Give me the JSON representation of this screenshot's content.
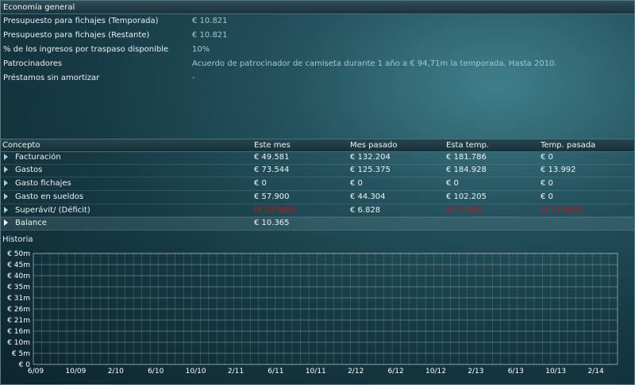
{
  "economia": {
    "title": "Economía general",
    "rows": [
      {
        "label": "Presupuesto para fichajes (Temporada)",
        "value": "€ 10.821"
      },
      {
        "label": "Presupuesto para fichajes (Restante)",
        "value": "€ 10.821"
      },
      {
        "label": "% de los ingresos por traspaso disponible",
        "value": "10%"
      },
      {
        "label": "Patrocinadores",
        "value": "Acuerdo de patrocinador de camiseta durante 1 año a € 94,71m la temporada. Hasta 2010."
      },
      {
        "label": "Préstamos sin amortizar",
        "value": "-"
      }
    ]
  },
  "table": {
    "headers": [
      "Concepto",
      "Este mes",
      "Mes pasado",
      "Esta temp.",
      "Temp. pasada"
    ],
    "rows": [
      {
        "name": "Facturación",
        "values": [
          "€ 49.581",
          "€ 132.204",
          "€ 181.786",
          "€ 0"
        ]
      },
      {
        "name": "Gastos",
        "values": [
          "€ 73.544",
          "€ 125.375",
          "€ 184.928",
          "€ 13.992"
        ]
      },
      {
        "name": "Gasto fichajes",
        "values": [
          "€ 0",
          "€ 0",
          "€ 0",
          "€ 0"
        ]
      },
      {
        "name": "Gasto en sueldos",
        "values": [
          "€ 57.900",
          "€ 44.304",
          "€ 102.205",
          "€ 0"
        ]
      },
      {
        "name": "Superávit/ (Déficit)",
        "values": [
          "(€ 23.963)",
          "€ 6.828",
          "(€ 3.142)",
          "(€ 13.992)"
        ]
      }
    ],
    "balance": {
      "name": "Balance",
      "value": "€ 10.365"
    }
  },
  "history": {
    "title": "Historia",
    "y_ticks": [
      "€ 0",
      "€ 5m",
      "€ 10m",
      "€ 16m",
      "€ 21m",
      "€ 26m",
      "€ 31m",
      "€ 35m",
      "€ 40m",
      "€ 45m",
      "€ 50m"
    ],
    "x_ticks": [
      "6/09",
      "10/09",
      "2/10",
      "6/10",
      "10/10",
      "2/11",
      "6/11",
      "10/11",
      "2/12",
      "6/12",
      "10/12",
      "2/13",
      "6/13",
      "10/13",
      "2/14"
    ]
  },
  "colors": {
    "negative": "#d01010",
    "accent_text": "#a6c8d2"
  }
}
